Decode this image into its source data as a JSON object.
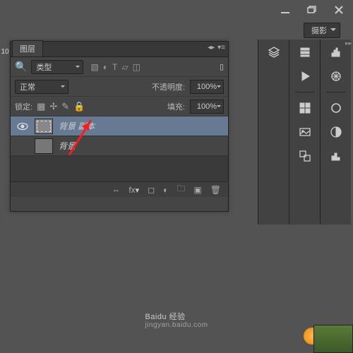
{
  "titlebar": {
    "minimize": "minimize",
    "restore": "restore",
    "close": "close"
  },
  "menubar": {
    "workspace": "摄影"
  },
  "left_gutter": "10",
  "layers_panel": {
    "tab_label": "图层",
    "filter_label": "类型",
    "filter_icons": [
      "image-filter",
      "adjust-filter",
      "type-filter",
      "shape-filter",
      "smart-filter"
    ],
    "blend_mode": "正常",
    "opacity_label": "不透明度:",
    "opacity_value": "100%",
    "lock_label": "锁定:",
    "lock_icons": [
      "lock-pixels",
      "lock-position",
      "lock-brush",
      "lock-all"
    ],
    "fill_label": "填充:",
    "fill_value": "100%",
    "layers": [
      {
        "visible": true,
        "name": "背景 副本",
        "selected": true
      },
      {
        "visible": false,
        "name": "背景",
        "selected": false
      }
    ],
    "footer_icons": [
      "link",
      "fx",
      "mask",
      "adjust",
      "group",
      "new",
      "trash"
    ]
  },
  "right_dock": {
    "col_a": [
      "layers-icon"
    ],
    "col_b": [
      "stack-icon",
      "play-icon",
      "grid-icon",
      "gallery-icon",
      "swap-icon"
    ],
    "col_c": [
      "histogram-icon",
      "wheel-icon",
      "circle-icon",
      "halftone-icon",
      "levels-icon"
    ]
  },
  "watermark": {
    "brand": "Baidu 经验",
    "url": "jingyan.baidu.com"
  }
}
